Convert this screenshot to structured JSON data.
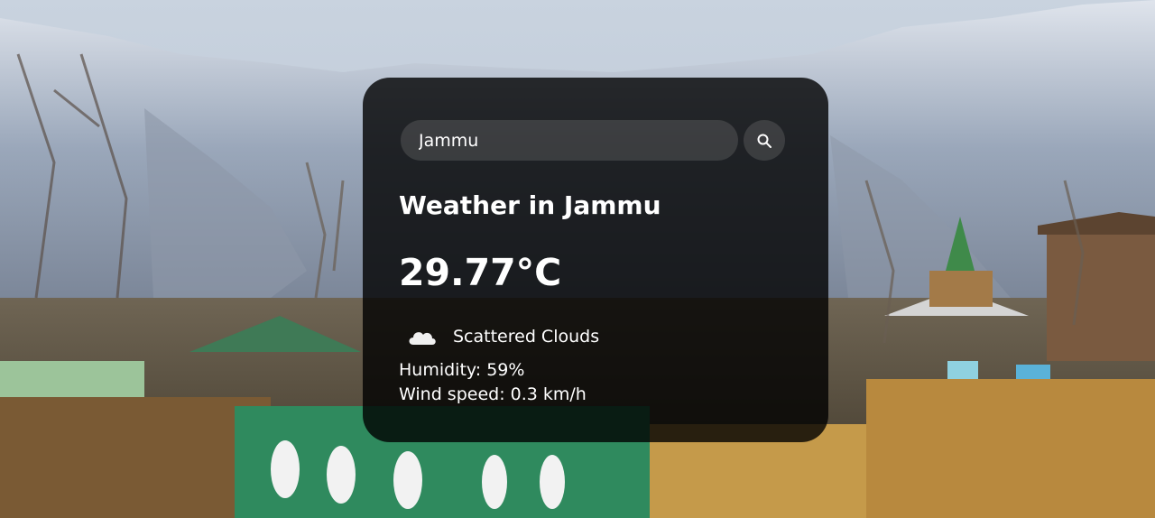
{
  "search": {
    "value": "Jammu",
    "button_icon": "search-icon"
  },
  "weather": {
    "heading": "Weather in Jammu",
    "temperature": "29.77°C",
    "condition_icon": "cloud-icon",
    "description": "Scattered Clouds",
    "humidity": "Humidity: 59%",
    "wind": "Wind speed: 0.3 km/h"
  },
  "colors": {
    "card_background": "#000000",
    "text": "#ffffff",
    "input_background": "#7d7d7d"
  }
}
